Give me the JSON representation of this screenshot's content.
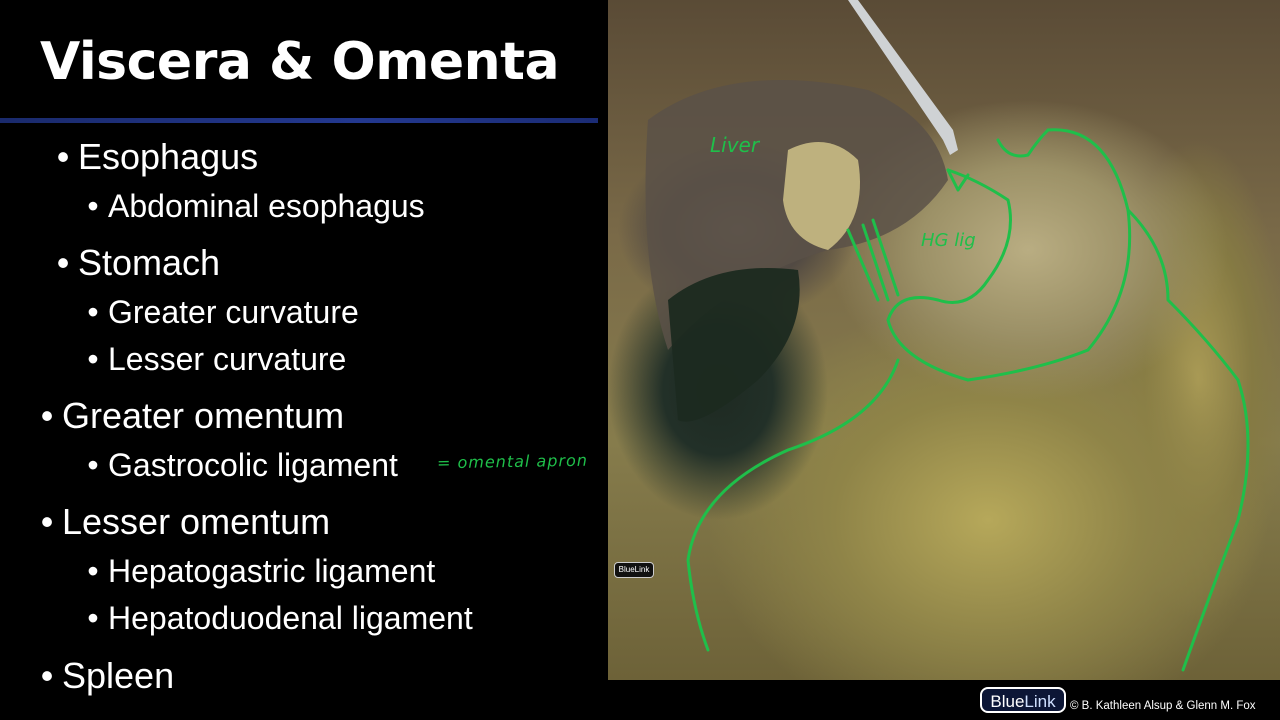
{
  "slide": {
    "title": "Viscera & Omenta",
    "bullets": [
      {
        "text": "Esophagus"
      },
      {
        "text": "Abdominal esophagus"
      },
      {
        "text": "Stomach"
      },
      {
        "text": "Greater curvature"
      },
      {
        "text": "Lesser curvature"
      },
      {
        "text": "Greater omentum"
      },
      {
        "text": "Gastrocolic ligament"
      },
      {
        "text": "Lesser omentum"
      },
      {
        "text": "Hepatogastric ligament"
      },
      {
        "text": "Hepatoduodenal ligament"
      },
      {
        "text": "Spleen"
      }
    ],
    "bullet_glyph": "•",
    "handwritten_note": "= omental apron"
  },
  "image": {
    "annotation_liver": "Liver",
    "annotation_hg": "HG lig",
    "annotation_color": "#1fbf4a"
  },
  "branding": {
    "small_logo": "BlueLink",
    "big_logo_blue": "Blue",
    "big_logo_link": "Link",
    "copyright": "© B. Kathleen Alsup & Glenn M. Fox"
  },
  "colors": {
    "background": "#000000",
    "title_rule": "#23388f",
    "annotation_green": "#1fbf4a"
  }
}
